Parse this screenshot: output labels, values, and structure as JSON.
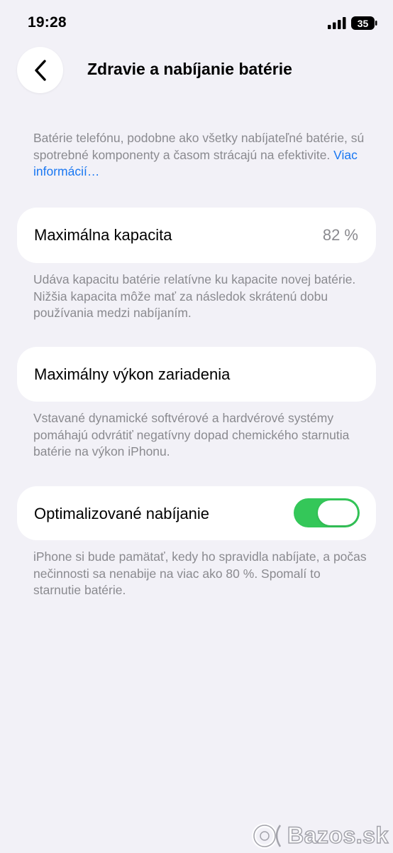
{
  "status_bar": {
    "time": "19:28",
    "battery_level": "35"
  },
  "header": {
    "title": "Zdravie a nabíjanie batérie"
  },
  "intro": {
    "text": "Batérie telefónu, podobne ako všetky nabíjateľné batérie, sú spotrebné komponenty a časom strácajú na efektivite. ",
    "link": "Viac informácií…"
  },
  "max_capacity": {
    "label": "Maximálna kapacita",
    "value": "82 %",
    "note": "Udáva kapacitu batérie relatívne ku kapacite novej batérie. Nižšia kapacita môže mať za následok skrátenú dobu používania medzi nabíjaním."
  },
  "peak_performance": {
    "label": "Maximálny výkon zariadenia",
    "note": "Vstavané dynamické softvérové a hardvérové systémy pomáhajú odvrátiť negatívny dopad chemického starnutia batérie na výkon iPhonu."
  },
  "optimized_charging": {
    "label": "Optimalizované nabíjanie",
    "enabled": true,
    "note": "iPhone si bude pamätať, kedy ho spravidla nabíjate, a počas nečinnosti sa nenabije na viac ako 80 %. Spomalí to starnutie batérie."
  },
  "watermark": {
    "text": "Bazos.sk"
  },
  "colors": {
    "background": "#f2f1f7",
    "link": "#1977f2",
    "toggle_on": "#34c759",
    "secondary_text": "#8a8a8f"
  }
}
